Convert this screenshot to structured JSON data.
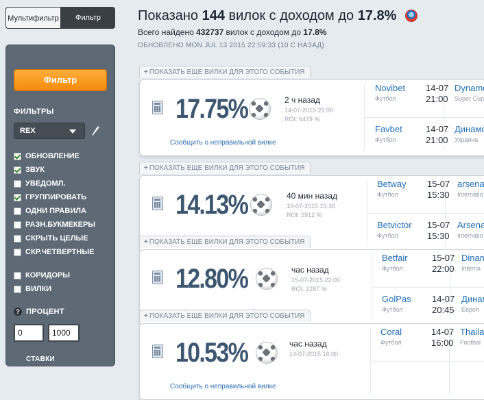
{
  "tabs": {
    "multifilter": "Мультифильтр",
    "filter": "Фильтр"
  },
  "sidebar": {
    "filter_button": "Фильтр",
    "filters_title": "ФИЛЬТРЫ",
    "selected_filter": "REX",
    "checkboxes": [
      {
        "label": "ОБНОВЛЕНИЕ",
        "checked": true
      },
      {
        "label": "ЗВУК",
        "checked": true
      },
      {
        "label": "УВЕДОМЛ.",
        "checked": false
      },
      {
        "label": "ГРУППИРОВАТЬ",
        "checked": true
      },
      {
        "label": "ОДНИ ПРАВИЛА",
        "checked": false
      },
      {
        "label": "РАЗН.БУКМЕКЕРЫ",
        "checked": false
      },
      {
        "label": "СКРЫТЬ ЦЕЛЫЕ",
        "checked": false
      },
      {
        "label": "СКР.ЧЕТВЕРТНЫЕ",
        "checked": false
      }
    ],
    "checkboxes2": [
      {
        "label": "КОРИДОРЫ",
        "checked": false
      },
      {
        "label": "ВИЛКИ",
        "checked": false
      }
    ],
    "percent_title": "ПРОЦЕНТ",
    "percent_from": "0",
    "percent_to": "1000",
    "bottom_title": "СТАВКИ"
  },
  "header": {
    "title_prefix": "Показано",
    "count": "144",
    "title_mid": "вилок с доходом до",
    "max_pct": "17.8%",
    "sub_prefix": "Всего найдено",
    "total": "432737",
    "sub_mid": "вилок с доходом до",
    "sub_pct": "17.8%",
    "updated_label": "ОБНОВЛЕНО",
    "updated_value": "MON JUL 13 2015 22:59:33 (10 С НАЗАД)"
  },
  "more_label": "ПОКАЗАТЬ ЕЩЕ ВИЛКИ ДЛЯ ЭТОГО СОБЫТИЯ",
  "report_label": "Сообщить о неправильной вилке",
  "cards": [
    {
      "percent": "17.75%",
      "age": "2 ч назад",
      "datetime": "14-07-2015 21:00",
      "roi": "ROI: 6479 %",
      "legs": [
        {
          "bookmaker": "Novibet",
          "sport": "Футбол",
          "date": "14-07",
          "time": "21:00",
          "team": "Dynamo",
          "league": "Super Cup"
        },
        {
          "bookmaker": "Favbet",
          "sport": "Футбол",
          "date": "14-07",
          "time": "21:00",
          "team": "Динамо",
          "league": "Украина"
        }
      ]
    },
    {
      "percent": "14.13%",
      "age": "40 мин назад",
      "datetime": "15-07-2015 15:30",
      "roi": "ROI: 2912 %",
      "legs": [
        {
          "bookmaker": "Betway",
          "sport": "Футбол",
          "date": "15-07",
          "time": "15:30",
          "team": "arsenal",
          "league": "Internatio"
        },
        {
          "bookmaker": "Betvictor",
          "sport": "Футбол",
          "date": "15-07",
          "time": "15:30",
          "team": "Arsenal",
          "league": "Internatio"
        }
      ]
    },
    {
      "percent": "12.80%",
      "age": "час назад",
      "datetime": "15-07-2015 22:00",
      "roi": "ROI: 2287 %",
      "legs": [
        {
          "bookmaker": "Betfair",
          "sport": "Футбол",
          "date": "15-07",
          "time": "22:00",
          "team": "Dinam",
          "league": "Interna"
        },
        {
          "bookmaker": "GolPas",
          "sport": "Футбол",
          "date": "14-07",
          "time": "20:45",
          "team": "Динам",
          "league": "Европ"
        }
      ]
    },
    {
      "percent": "10.53%",
      "age": "час назад",
      "datetime": "14-07-2015 16:00",
      "roi": "",
      "legs": [
        {
          "bookmaker": "Coral",
          "sport": "Футбол",
          "date": "14-07",
          "time": "16:00",
          "team": "Thaila",
          "league": "Footbal"
        }
      ]
    }
  ]
}
